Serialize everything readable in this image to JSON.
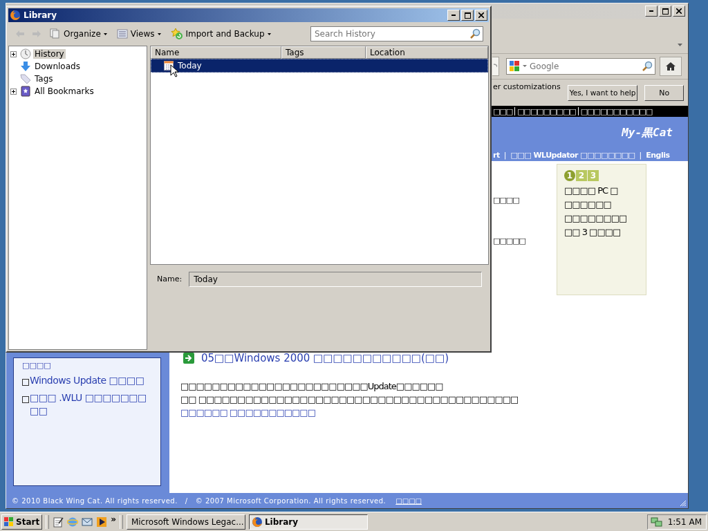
{
  "browser": {
    "search": {
      "placeholder": "Google"
    },
    "notification": {
      "text": "er customizations",
      "buttons": [
        {
          "label": "Yes, I want to help"
        },
        {
          "label": "No"
        }
      ]
    },
    "page": {
      "top_bar": [
        "□□□",
        "□□□□□□□□□",
        "□□□□□□□□□□□"
      ],
      "logo": "My-黒Cat",
      "nav": [
        "rt",
        "□□□ WLUpdator □□□□□□□□",
        "Englis"
      ],
      "nav_separator": "|",
      "sidebar": {
        "cut_line": "□□□□",
        "items": [
          {
            "text": "Windows Update □□□□"
          },
          {
            "text": "□□□ .WLU □□□□□□□□□"
          }
        ]
      },
      "fragments": [
        "□□□□",
        "□□□□□"
      ],
      "side_box": {
        "tabs": [
          {
            "label": "1",
            "selected": true
          },
          {
            "label": "2",
            "selected": false
          },
          {
            "label": "3",
            "selected": false
          }
        ],
        "lines": [
          "□□□□ PC □",
          "□□□□□□",
          "□□□□□□□□",
          "□□ 3 □□□□"
        ]
      },
      "article_title": "05□□Windows 2000 □□□□□□□□□□□(□□)",
      "paragraph": [
        "□□□□□□□□□□□□□□□□□□□□□□□□Update□□□□□□",
        "□□ □□□□□□□□□□□□□□□□□□□□□□□□□□□□□□□□□□□□□□□□□",
        "□□□□□□ □□□□□□□□□□□"
      ],
      "footer": {
        "copyright": "© 2010 Black Wing Cat. All rights reserved.   /   © 2007 Microsoft Corporation. All rights reserved.",
        "link": "□□□□"
      }
    }
  },
  "library": {
    "title": "Library",
    "toolbar": [
      {
        "label": "Organize"
      },
      {
        "label": "Views"
      },
      {
        "label": "Import and Backup"
      }
    ],
    "search": {
      "placeholder": "Search History"
    },
    "tree": [
      {
        "label": "History",
        "expandable": true,
        "selected": true
      },
      {
        "label": "Downloads",
        "expandable": false,
        "selected": false
      },
      {
        "label": "Tags",
        "expandable": false,
        "selected": false
      },
      {
        "label": "All Bookmarks",
        "expandable": true,
        "selected": false
      }
    ],
    "columns": [
      "Name",
      "Tags",
      "Location"
    ],
    "rows": [
      {
        "name": "Today",
        "selected": true
      }
    ],
    "details": {
      "label": "Name:",
      "value": "Today"
    }
  },
  "taskbar": {
    "start": "Start",
    "more": "»",
    "tasks": [
      {
        "label": "Microsoft Windows Legac...",
        "selected": false
      },
      {
        "label": "Library",
        "selected": true
      }
    ],
    "clock": "1:51 AM"
  }
}
